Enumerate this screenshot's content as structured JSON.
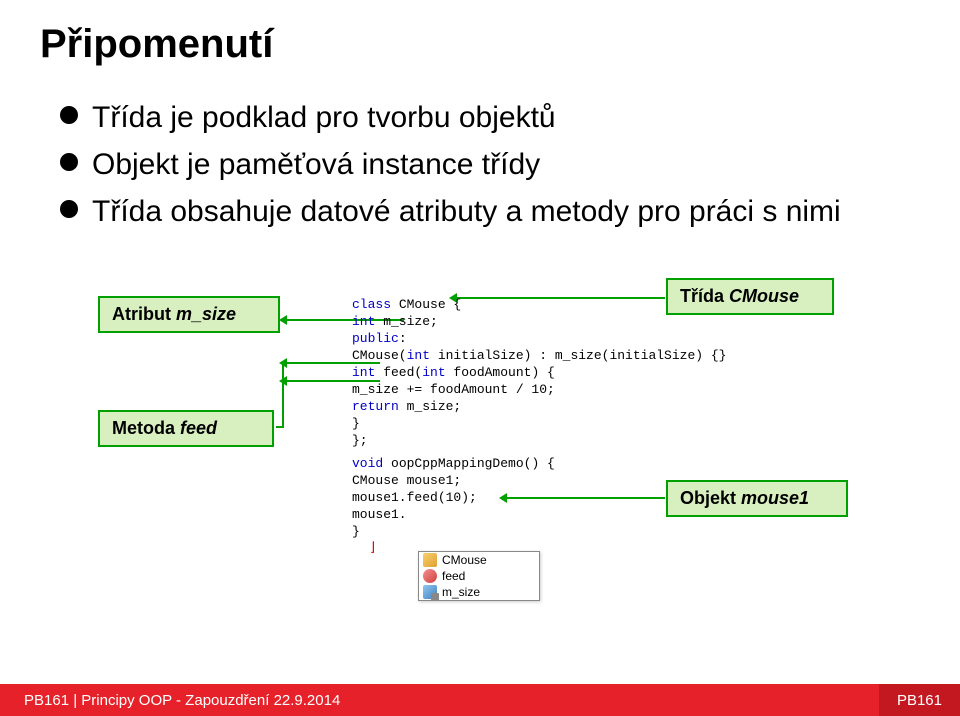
{
  "title": "Připomenutí",
  "bullets": [
    "Třída je podklad pro tvorbu objektů",
    "Objekt je paměťová instance třídy",
    "Třída obsahuje datové atributy a metody pro práci s nimi"
  ],
  "labels": {
    "attrib_prefix": "Atribut ",
    "attrib_name": "m_size",
    "class_prefix": "Třída ",
    "class_name": "CMouse",
    "method_prefix": "Metoda ",
    "method_name": "feed",
    "object_prefix": "Objekt ",
    "object_name": "mouse1"
  },
  "code": {
    "l1a": "class",
    "l1b": " CMouse {",
    "l2a": "    int",
    "l2b": " m_size;",
    "l3a": "public",
    "l3b": ":",
    "l4": "    CMouse(",
    "l4b": "int",
    "l4c": " initialSize) : m_size(initialSize) {}",
    "l5a": "    int",
    "l5b": " feed(",
    "l5c": "int",
    "l5d": " foodAmount) {",
    "l6": "        m_size += foodAmount / 10;",
    "l7a": "        return",
    "l7b": " m_size;",
    "l8": "    }",
    "l9": "};",
    "l10a": "void",
    "l10b": " oopCppMappingDemo() {",
    "l11": "    CMouse mouse1;",
    "l12": "    mouse1.feed(10);",
    "l13": "    mouse1.",
    "l14": "}"
  },
  "popup": {
    "items": [
      "CMouse",
      "feed",
      "m_size"
    ]
  },
  "cursor": "⌋",
  "footer": {
    "left": "PB161 | Principy OOP - Zapouzdření 22.9.2014",
    "right": "PB161"
  }
}
